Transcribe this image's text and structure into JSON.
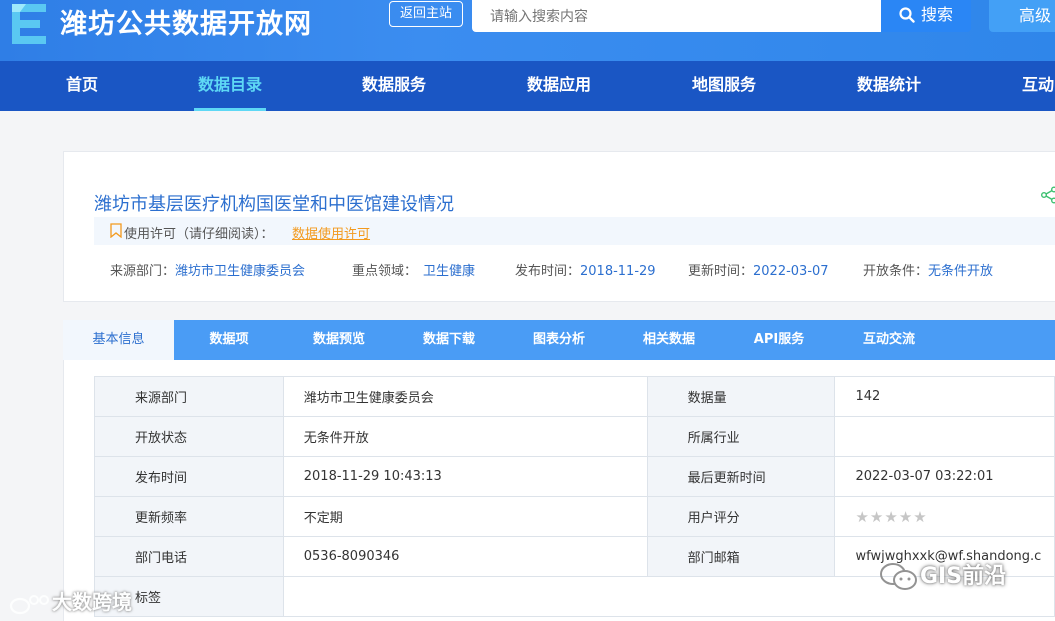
{
  "header": {
    "site_title": "潍坊公共数据开放网",
    "back_label": "返回主站",
    "search_placeholder": "请输入搜索内容",
    "search_label": "搜索",
    "advanced_label": "高级"
  },
  "nav": {
    "items": [
      {
        "label": "首页"
      },
      {
        "label": "数据目录",
        "active": true
      },
      {
        "label": "数据服务"
      },
      {
        "label": "数据应用"
      },
      {
        "label": "地图服务"
      },
      {
        "label": "数据统计"
      },
      {
        "label": "互动"
      }
    ]
  },
  "dataset": {
    "title": "潍坊市基层医疗机构国医堂和中医馆建设情况",
    "license_text": "使用许可（请仔细阅读）：",
    "license_link": "数据使用许可",
    "meta": {
      "source_key": "来源部门：",
      "source_val": "潍坊市卫生健康委员会",
      "field_key": "重点领域：",
      "field_val": "卫生健康",
      "publish_key": "发布时间：",
      "publish_val": "2018-11-29",
      "update_key": "更新时间：",
      "update_val": "2022-03-07",
      "open_key": "开放条件：",
      "open_val": "无条件开放"
    }
  },
  "tabs": [
    {
      "label": "基本信息",
      "active": true
    },
    {
      "label": "数据项"
    },
    {
      "label": "数据预览"
    },
    {
      "label": "数据下载"
    },
    {
      "label": "图表分析"
    },
    {
      "label": "相关数据"
    },
    {
      "label": "API服务"
    },
    {
      "label": "互动交流"
    }
  ],
  "info": {
    "rows": [
      [
        "来源部门",
        "潍坊市卫生健康委员会",
        "数据量",
        "142"
      ],
      [
        "开放状态",
        "无条件开放",
        "所属行业",
        ""
      ],
      [
        "发布时间",
        "2018-11-29 10:43:13",
        "最后更新时间",
        "2022-03-07 03:22:01"
      ],
      [
        "更新频率",
        "不定期",
        "用户评分",
        ""
      ],
      [
        "部门电话",
        "0536-8090346",
        "部门邮箱",
        "wfwjwghxxk@wf.shandong.c"
      ],
      [
        "标签",
        ""
      ]
    ],
    "rating": 0,
    "rating_max": 5
  },
  "watermarks": {
    "left": "大数跨境",
    "right": "GIS前沿"
  },
  "colors": {
    "header_blue": "#2f7ee6",
    "nav_blue": "#1a56c4",
    "nav_active": "#5ed8f5",
    "tab_bar": "#4a9cf5",
    "link_blue": "#2c6fcf",
    "license_orange": "#f39a1e"
  },
  "icons": [
    "logo-icon",
    "search-icon",
    "share-icon",
    "bookmark-icon",
    "star-icon",
    "wechat-icon"
  ]
}
